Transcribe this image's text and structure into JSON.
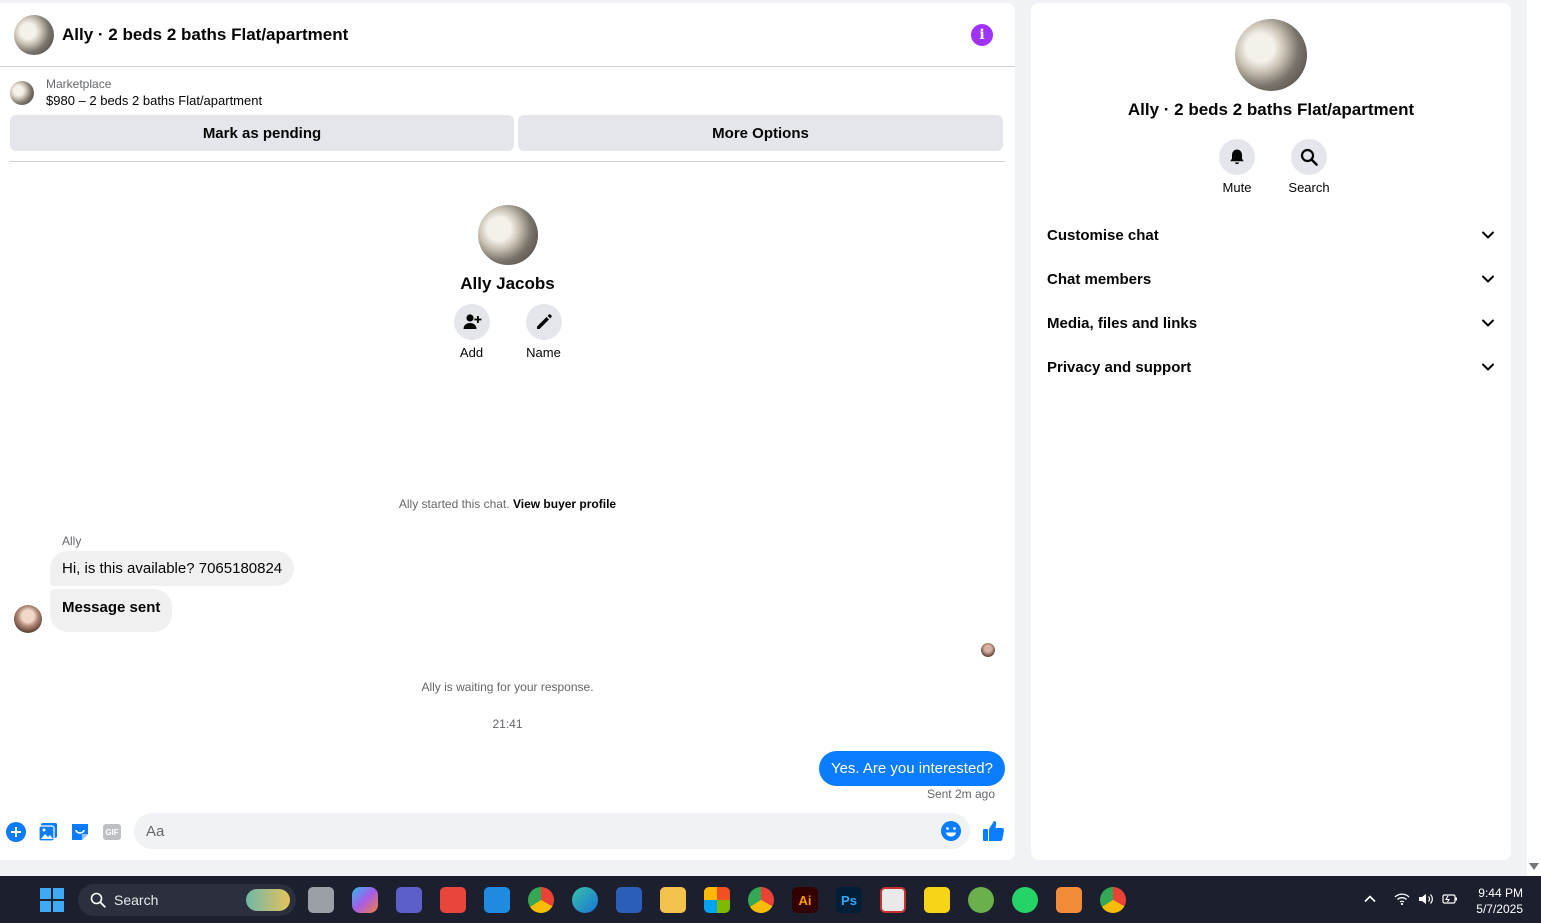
{
  "chat": {
    "header": {
      "title": "Ally · 2 beds 2 baths Flat/apartment"
    },
    "listing": {
      "label": "Marketplace",
      "price_line": "$980 – 2 beds 2 baths Flat/apartment",
      "mark_pending": "Mark as pending",
      "more_options": "More Options"
    },
    "profile": {
      "name": "Ally Jacobs",
      "add_label": "Add",
      "name_label": "Name"
    },
    "started_text": "Ally started this chat.",
    "view_profile": "View buyer profile",
    "sender": "Ally",
    "messages_in": [
      "Hi, is this available? 7065180824",
      "Message sent"
    ],
    "waiting_text": "Ally is waiting for your response.",
    "timestamp": "21:41",
    "message_out": "Yes. Are you interested?",
    "sent_status": "Sent 2m ago",
    "composer": {
      "placeholder": "Aa",
      "gif_label": "GIF"
    }
  },
  "info_panel": {
    "title": "Ally · 2 beds 2 baths Flat/apartment",
    "mute_label": "Mute",
    "search_label": "Search",
    "sections": [
      "Customise chat",
      "Chat members",
      "Media, files and links",
      "Privacy and support"
    ]
  },
  "taskbar": {
    "search_label": "Search",
    "time": "9:44 PM",
    "date": "5/7/2025",
    "apps": [
      "file-explorer-window",
      "copilot",
      "teams",
      "git-app",
      "mail",
      "chrome",
      "edge",
      "word",
      "file-explorer",
      "store",
      "chrome-profile",
      "illustrator",
      "photoshop",
      "snipping-tool",
      "sticky-notes",
      "utorrent",
      "whatsapp",
      "app-orange",
      "chrome-alt"
    ]
  },
  "colors": {
    "accent_blue": "#0a7cff",
    "info_purple": "#a033ff",
    "taskbar_bg": "#1c1f2e"
  }
}
